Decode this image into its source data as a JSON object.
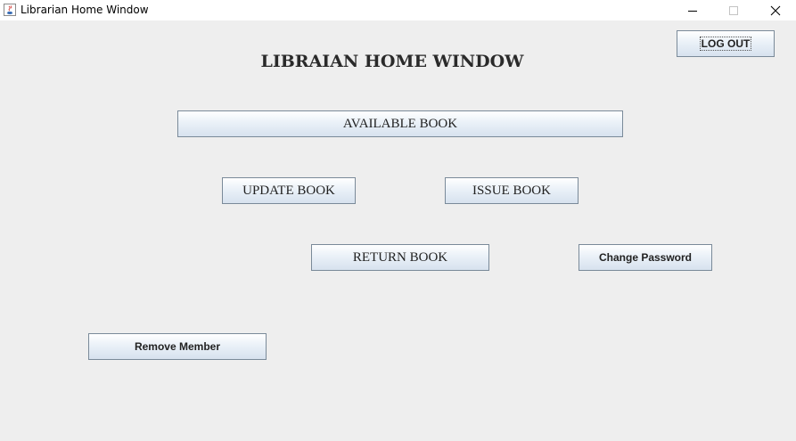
{
  "window": {
    "title": "Librarian Home Window",
    "controls": {
      "minimize": "minimize-icon",
      "maximize": "maximize-icon",
      "close": "close-icon"
    }
  },
  "main": {
    "heading": "LIBRAIAN HOME WINDOW",
    "buttons": {
      "logout": "LOG OUT",
      "available_book": "AVAILABLE BOOK",
      "update_book": "UPDATE BOOK",
      "issue_book": "ISSUE BOOK",
      "return_book": "RETURN BOOK",
      "change_password": "Change Password",
      "remove_member": "Remove Member"
    }
  },
  "colors": {
    "background": "#eeeeee",
    "button_border": "#7a8a99",
    "button_gradient_top": "#ffffff",
    "button_gradient_bottom": "#d7e2ee"
  }
}
